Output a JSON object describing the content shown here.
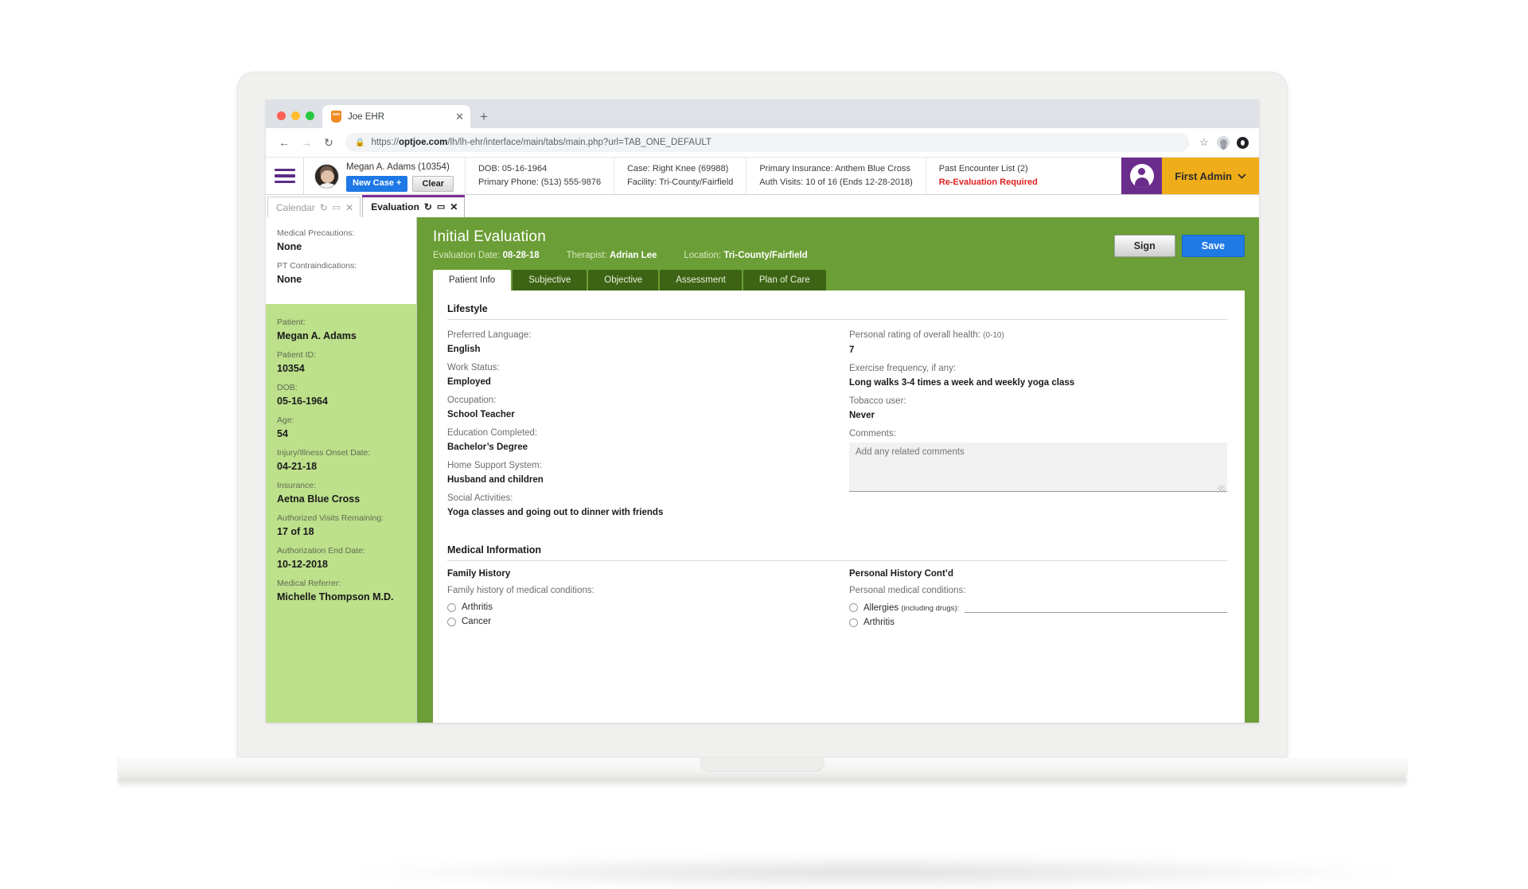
{
  "browser": {
    "tab_title": "Joe EHR",
    "tab_close": "✕",
    "new_tab": "+",
    "back": "←",
    "forward": "→",
    "reload": "↻",
    "lock": "🔒",
    "url_scheme": "https://",
    "url_domain": "optjoe.com",
    "url_path": "/lh/lh-ehr/interface/main/tabs/main.php?url=TAB_ONE_DEFAULT",
    "bookmark_star": "☆"
  },
  "header": {
    "patient_name_id": "Megan A. Adams (10354)",
    "new_case_label": "New Case +",
    "clear_label": "Clear",
    "col_dob": "DOB: 05-16-1964",
    "col_phone": "Primary Phone: (513) 555-9876",
    "col_case": "Case: Right Knee (69988)",
    "col_facility": "Facility: Tri-County/Fairfield",
    "col_insurance": "Primary Insurance: Anthem Blue Cross",
    "col_auth": "Auth Visits: 10 of 16 (Ends 12-28-2018)",
    "col_past_encounter": "Past Encounter List (2)",
    "col_reeval": "Re-Evaluation Required",
    "admin_label": "First Admin",
    "admin_caret": "⌄",
    "accent_purple": "#6b2d8c",
    "accent_yellow": "#f0ad1a",
    "alert_red": "#e02020"
  },
  "app_tabs": [
    {
      "label": "Calendar",
      "refresh": "↻",
      "window": "▭",
      "close": "✕",
      "active": false
    },
    {
      "label": "Evaluation",
      "refresh": "↻",
      "window": "▭",
      "close": "✕",
      "active": true
    }
  ],
  "sidebar": {
    "top": [
      {
        "label": "Medical Precautions:",
        "value": "None"
      },
      {
        "label": "PT Contraindications:",
        "value": "None"
      }
    ],
    "details": [
      {
        "label": "Patient:",
        "value": "Megan A. Adams"
      },
      {
        "label": "Patient ID:",
        "value": "10354"
      },
      {
        "label": "DOB:",
        "value": "05-16-1964"
      },
      {
        "label": "Age:",
        "value": "54"
      },
      {
        "label": "Injury/Illness Onset Date:",
        "value": "04-21-18"
      },
      {
        "label": "Insurance:",
        "value": "Aetna Blue Cross"
      },
      {
        "label": "Authorized Visits Remaining:",
        "value": "17 of 18"
      },
      {
        "label": "Authorization End Date:",
        "value": "10-12-2018"
      },
      {
        "label": "Medical Referrer:",
        "value": "Michelle Thompson M.D."
      }
    ]
  },
  "evaluation": {
    "title": "Initial Evaluation",
    "meta": [
      {
        "label": "Evaluation Date:",
        "value": "08-28-18"
      },
      {
        "label": "Therapist:",
        "value": "Adrian Lee"
      },
      {
        "label": "Location:",
        "value": "Tri-County/Fairfield"
      }
    ],
    "sign_label": "Sign",
    "save_label": "Save",
    "green": "#6b9e36",
    "tabs": [
      {
        "label": "Patient Info",
        "active": true
      },
      {
        "label": "Subjective",
        "active": false
      },
      {
        "label": "Objective",
        "active": false
      },
      {
        "label": "Assessment",
        "active": false
      },
      {
        "label": "Plan of Care",
        "active": false
      }
    ]
  },
  "lifestyle": {
    "section_title": "Lifestyle",
    "left": [
      {
        "label": "Preferred Language:",
        "value": "English"
      },
      {
        "label": "Work Status:",
        "value": "Employed"
      },
      {
        "label": "Occupation:",
        "value": "School Teacher"
      },
      {
        "label": "Education Completed:",
        "value": "Bachelor’s Degree"
      },
      {
        "label": "Home Support System:",
        "value": "Husband and children"
      },
      {
        "label": "Social Activities:",
        "value": "Yoga classes and going out to dinner with friends"
      }
    ],
    "right": [
      {
        "label": "Personal rating of overall health:",
        "label_small": "(0-10)",
        "value": "7"
      },
      {
        "label": "Exercise frequency, if any:",
        "value": "Long walks 3-4 times a week and weekly yoga class"
      },
      {
        "label": "Tobacco user:",
        "value": "Never"
      }
    ],
    "comments_label": "Comments:",
    "comments_placeholder": "Add any related comments",
    "comments_value": ""
  },
  "medical_information": {
    "section_title": "Medical Information",
    "family_history": {
      "title": "Family History",
      "prompt": "Family history of medical conditions:",
      "options": [
        {
          "label": "Arthritis",
          "checked": false
        },
        {
          "label": "Cancer",
          "checked": false
        }
      ]
    },
    "personal_history": {
      "title": "Personal History Cont’d",
      "prompt": "Personal medical conditions:",
      "options": [
        {
          "label": "Allergies",
          "label_small": "(including drugs):",
          "checked": false,
          "has_field": true,
          "field_value": ""
        },
        {
          "label": "Arthritis",
          "checked": false,
          "has_field": false
        }
      ]
    }
  }
}
